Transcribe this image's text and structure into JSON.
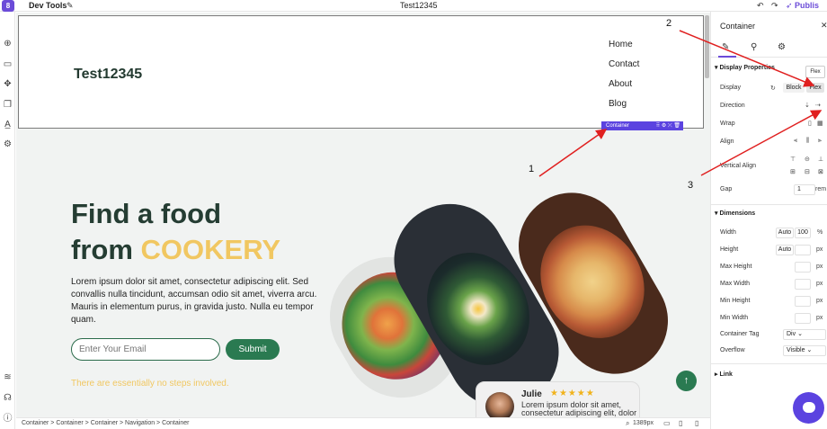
{
  "topbar": {
    "logo": "8",
    "app_title": "Dev Tools",
    "doc_title": "Test12345",
    "publish_label": "Publis"
  },
  "canvas": {
    "brand": "Test12345",
    "nav_items": [
      "Home",
      "Contact",
      "About",
      "Blog"
    ],
    "container_badge": "Container",
    "hero_line1": "Find a food",
    "hero_line2_prefix": "from",
    "hero_line2_highlight": "COOKERY",
    "paragraph": "Lorem ipsum dolor sit amet, consectetur adipiscing elit. Sed convallis nulla tincidunt, accumsan odio sit amet, viverra arcu. Mauris in elementum purus, in gravida justo. Nulla eu tempor quam.",
    "email_placeholder": "Enter Your Email",
    "submit_label": "Submit",
    "steps_text": "There are essentially no steps involved.",
    "review": {
      "name": "Julie",
      "stars": "★★★★★",
      "text": "Lorem ipsum dolor sit amet, consectetur adipiscing elit, dolor sit amet."
    },
    "up_icon": "↑"
  },
  "statusbar": {
    "breadcrumb": [
      "Container",
      "Container",
      "Container",
      "Navigation",
      "Container"
    ],
    "zoom": "1389px"
  },
  "panel": {
    "title": "Container",
    "display_section": "Display Properties",
    "display_label": "Display",
    "display_options": [
      "Block",
      "Flex"
    ],
    "direction_label": "Direction",
    "wrap_label": "Wrap",
    "align_label": "Align",
    "vertical_align_label": "Vertical Align",
    "gap_label": "Gap",
    "gap_value": "1",
    "gap_unit": "rem",
    "dimensions_section": "Dimensions",
    "width_label": "Width",
    "width_auto": "Auto",
    "width_value": "100",
    "width_unit": "%",
    "height_label": "Height",
    "height_auto": "Auto",
    "height_unit": "px",
    "max_height_label": "Max Height",
    "max_width_label": "Max Width",
    "min_height_label": "Min Height",
    "min_width_label": "Min Width",
    "px": "px",
    "container_tag_label": "Container Tag",
    "container_tag_value": "Div",
    "overflow_label": "Overflow",
    "overflow_value": "Visible",
    "link_section": "Link",
    "tooltip": "Flex"
  },
  "annotations": [
    "1",
    "2",
    "3"
  ],
  "colors": {
    "accent": "#6b4bd8",
    "brand_green": "#2a7a51",
    "highlight_yellow": "#f1c761",
    "arrow_red": "#e02020"
  }
}
